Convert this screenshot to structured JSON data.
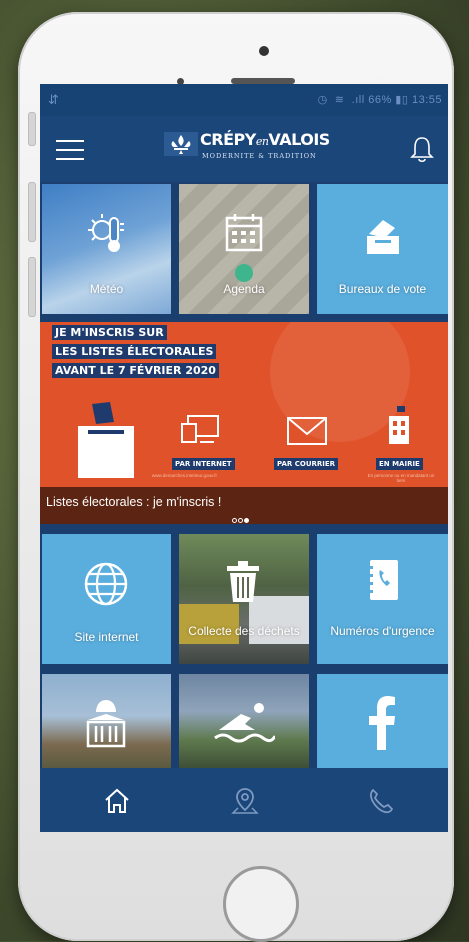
{
  "status": {
    "left_icon": "signal-arrows-icon",
    "right_text": "66%",
    "time": "13:55"
  },
  "header": {
    "logo_name_1": "CRÉPY",
    "logo_name_en": "en",
    "logo_name_2": "VALOIS",
    "logo_tagline": "MODERNITE & TRADITION",
    "menu_icon": "hamburger-icon",
    "notification_icon": "bell-icon"
  },
  "tiles_row1": [
    {
      "label": "Météo",
      "icon": "thermometer-sun-icon",
      "bg": "#4d86c4"
    },
    {
      "label": "Agenda",
      "icon": "calendar-icon",
      "bg": "#9c9a8f"
    },
    {
      "label": "Bureaux de vote",
      "icon": "ballot-box-icon",
      "bg": "#5aaedd"
    }
  ],
  "banner": {
    "line1": "JE M'INSCRIS SUR",
    "line2": "LES LISTES ÉLECTORALES",
    "line3": "AVANT LE 7 FÉVRIER 2020",
    "opt1": "PAR INTERNET",
    "opt2": "PAR COURRIER",
    "opt3": "EN MAIRIE",
    "url": "www.demarches.interieur.gouv.fr",
    "mairie_note": "En personne ou en mandatant un tiers",
    "caption": "Listes électorales : je m'inscris !",
    "slide_count": 3,
    "active_slide": 3
  },
  "tiles_row2": [
    {
      "label": "Site internet",
      "icon": "globe-icon",
      "bg": "#5aaedd"
    },
    {
      "label": "Collecte des déchets",
      "icon": "trash-icon",
      "bg": "#5d6a4f"
    },
    {
      "label": "Numéros d'urgence",
      "icon": "phone-book-icon",
      "bg": "#5aaedd"
    }
  ],
  "tiles_row3": [
    {
      "label": "",
      "icon": "town-hall-icon",
      "bg": "#7a8a9a"
    },
    {
      "label": "",
      "icon": "swimmer-icon",
      "bg": "#6c7f95"
    },
    {
      "label": "",
      "icon": "facebook-icon",
      "bg": "#5aaedd"
    }
  ],
  "tabbar": {
    "home_icon": "home-icon",
    "map_icon": "map-pin-icon",
    "phone_icon": "phone-icon"
  },
  "colors": {
    "navy": "#1b4679",
    "banner_orange": "#e0532a",
    "tile_blue": "#5aaedd"
  }
}
